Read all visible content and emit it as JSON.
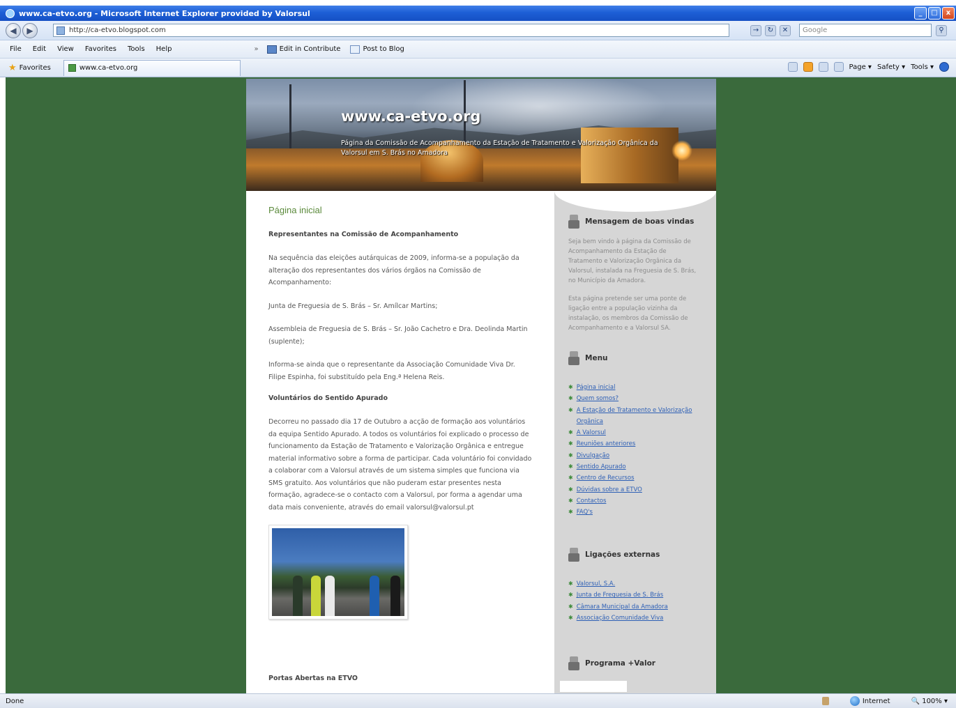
{
  "window": {
    "title": "www.ca-etvo.org - Microsoft Internet Explorer provided by Valorsul",
    "controls": {
      "minimize": "_",
      "maximize": "□",
      "close": "x"
    }
  },
  "address_bar": {
    "url": "http://ca-etvo.blogspot.com",
    "search_placeholder": "Google"
  },
  "menu": {
    "items": [
      "File",
      "Edit",
      "View",
      "Favorites",
      "Tools",
      "Help"
    ],
    "toolbar": [
      "Edit in Contribute",
      "Post to Blog"
    ]
  },
  "favorites_bar": {
    "favorites_label": "Favorites",
    "tab_label": "www.ca-etvo.org",
    "commands": [
      "Page ▾",
      "Safety ▾",
      "Tools ▾"
    ]
  },
  "banner": {
    "site_title": "www.ca-etvo.org",
    "site_description": "Página da Comissão de Acompanhamento da Estação de Tratamento e Valorização Orgânica da Valorsul em S. Brás no Amadora"
  },
  "main": {
    "post_title": "Página inicial",
    "heading_1": "Representantes na Comissão de Acompanhamento",
    "paragraphs_1": [
      "Na sequência das eleições autárquicas de 2009, informa-se a população da alteração dos representantes dos vários órgãos na Comissão de Acompanhamento:",
      "Junta de Freguesia de S. Brás – Sr. Amílcar Martins;",
      "Assembleia de Freguesia de S. Brás – Sr. João Cachetro e Dra. Deolinda Martin (suplente);",
      "Informa-se ainda que o representante da Associação Comunidade Viva Dr. Filipe Espinha, foi substituído pela Eng.ª Helena Reis."
    ],
    "heading_2": "Voluntários do Sentido Apurado",
    "paragraph_2": "Decorreu no passado dia 17 de Outubro a acção de formação aos voluntários da equipa Sentido Apurado. A todos os voluntários foi explicado o processo de funcionamento da Estação de Tratamento e Valorização Orgânica e entregue material informativo sobre a forma de participar. Cada voluntário foi convidado a colaborar com a Valorsul através de um sistema simples que funciona via SMS gratuito. Aos voluntários que não puderam estar presentes nesta formação, agradece-se o contacto com a Valorsul, por forma a agendar uma data mais conveniente, através do email valorsul@valorsul.pt",
    "heading_3": "Portas Abertas na ETVO"
  },
  "sidebar": {
    "welcome_title": "Mensagem de boas vindas",
    "welcome_text_1": "Seja bem vindo à página da Comissão de Acompanhamento da Estação de Tratamento e Valorização Orgânica da Valorsul, instalada na Freguesia de S. Brás, no Município da Amadora.",
    "welcome_text_2": "Esta página pretende ser uma ponte de ligação entre a população vizinha da instalação, os membros da Comissão de Acompanhamento e a Valorsul SA.",
    "menu_title": "Menu",
    "menu_links": [
      "Página inicial",
      "Quem somos?",
      "A Estação de Tratamento e Valorização Orgânica",
      "A Valorsul",
      "Reuniões anteriores",
      "Divulgação",
      "Sentido Apurado",
      "Centro de Recursos",
      "Dúvidas sobre a ETVO",
      "Contactos",
      "FAQ's"
    ],
    "external_title": "Ligações externas",
    "external_links": [
      "Valorsul, S.A.",
      "Junta de Freguesia de S. Brás",
      "Câmara Municipal da Amadora",
      "Associação Comunidade Viva"
    ],
    "program_title": "Programa +Valor"
  },
  "status_bar": {
    "status": "Done",
    "zone": "Internet",
    "zoom": "100%"
  }
}
